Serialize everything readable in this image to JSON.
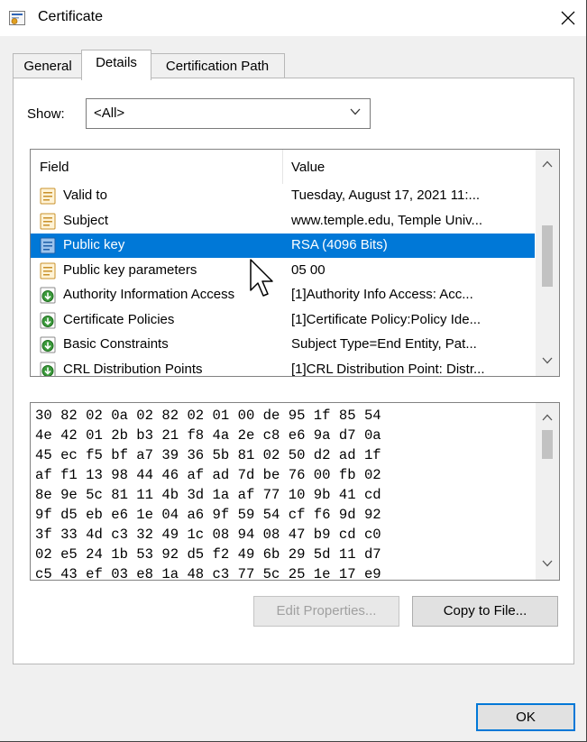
{
  "window": {
    "title": "Certificate",
    "close_glyph": "✕"
  },
  "tabs": [
    {
      "label": "General",
      "active": false
    },
    {
      "label": "Details",
      "active": true
    },
    {
      "label": "Certification Path",
      "active": false
    }
  ],
  "show": {
    "label": "Show:",
    "value": "<All>"
  },
  "field_list": {
    "columns": {
      "field": "Field",
      "value": "Value"
    },
    "rows": [
      {
        "field": "Valid to",
        "value": "Tuesday, August 17, 2021 11:...",
        "icon": "certificate-field-icon",
        "selected": false
      },
      {
        "field": "Subject",
        "value": "www.temple.edu, Temple Univ...",
        "icon": "certificate-field-icon",
        "selected": false
      },
      {
        "field": "Public key",
        "value": "RSA (4096 Bits)",
        "icon": "certificate-field-icon",
        "selected": true
      },
      {
        "field": "Public key parameters",
        "value": "05 00",
        "icon": "certificate-field-icon",
        "selected": false
      },
      {
        "field": "Authority Information Access",
        "value": "[1]Authority Info Access: Acc...",
        "icon": "extension-icon",
        "selected": false
      },
      {
        "field": "Certificate Policies",
        "value": "[1]Certificate Policy:Policy Ide...",
        "icon": "extension-icon",
        "selected": false
      },
      {
        "field": "Basic Constraints",
        "value": "Subject Type=End Entity, Pat...",
        "icon": "extension-icon",
        "selected": false
      },
      {
        "field": "CRL Distribution Points",
        "value": "[1]CRL Distribution Point: Distr...",
        "icon": "extension-icon",
        "selected": false
      }
    ]
  },
  "hex_lines": [
    "30 82 02 0a 02 82 02 01 00 de 95 1f 85 54",
    "4e 42 01 2b b3 21 f8 4a 2e c8 e6 9a d7 0a",
    "45 ec f5 bf a7 39 36 5b 81 02 50 d2 ad 1f",
    "af f1 13 98 44 46 af ad 7d be 76 00 fb 02",
    "8e 9e 5c 81 11 4b 3d 1a af 77 10 9b 41 cd",
    "9f d5 eb e6 1e 04 a6 9f 59 54 cf f6 9d 92",
    "3f 33 4d c3 32 49 1c 08 94 08 47 b9 cd c0",
    "02 e5 24 1b 53 92 d5 f2 49 6b 29 5d 11 d7",
    "c5 43 ef 03 e8 1a 48 c3 77 5c 25 1e 17 e9"
  ],
  "buttons": {
    "edit_properties": "Edit Properties...",
    "copy_to_file": "Copy to File...",
    "ok": "OK"
  },
  "colors": {
    "selection": "#0078d7",
    "ok_border": "#0078d7"
  }
}
